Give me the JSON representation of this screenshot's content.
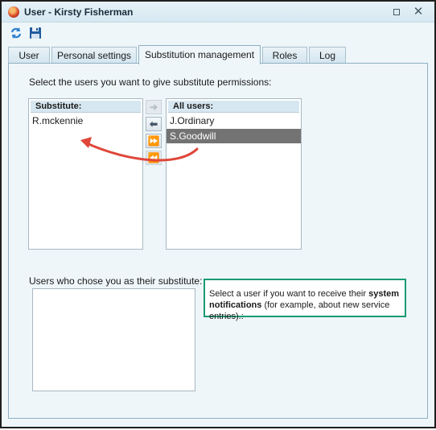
{
  "window": {
    "title": "User - Kirsty Fisherman",
    "controls": {
      "restore": "restore",
      "close": "✕"
    }
  },
  "toolbar": {
    "refresh_icon": "refresh-icon",
    "save_icon": "save-icon"
  },
  "tabs": [
    {
      "label": "User",
      "active": false
    },
    {
      "label": "Personal settings",
      "active": false
    },
    {
      "label": "Substitution management",
      "active": true
    },
    {
      "label": "Roles",
      "active": false
    },
    {
      "label": "Log",
      "active": false
    }
  ],
  "substitution": {
    "instruction": "Select the users you want to give substitute permissions:",
    "substitute_list": {
      "header": "Substitute:",
      "items": [
        "R.mckennie"
      ]
    },
    "all_users_list": {
      "header": "All users:",
      "items": [
        {
          "label": "J.Ordinary",
          "selected": false
        },
        {
          "label": "S.Goodwill",
          "selected": true
        }
      ]
    },
    "move_buttons": [
      {
        "name": "move-right",
        "glyph": "➜",
        "enabled": false
      },
      {
        "name": "move-left",
        "glyph": "⬅",
        "enabled": true
      },
      {
        "name": "move-all-right",
        "glyph": "⏩",
        "enabled": true
      },
      {
        "name": "move-all-left",
        "glyph": "⏪",
        "enabled": false
      }
    ],
    "chose_you_label": "Users who chose you as their substitute:",
    "callout": {
      "before": "Select a user if you want to receive their ",
      "bold": "system notifications",
      "after": " (for example, about new service entries).:"
    }
  },
  "colors": {
    "accent_teal": "#1a9a74",
    "annotation_arrow": "#e0463a",
    "selected_row": "#737373"
  }
}
